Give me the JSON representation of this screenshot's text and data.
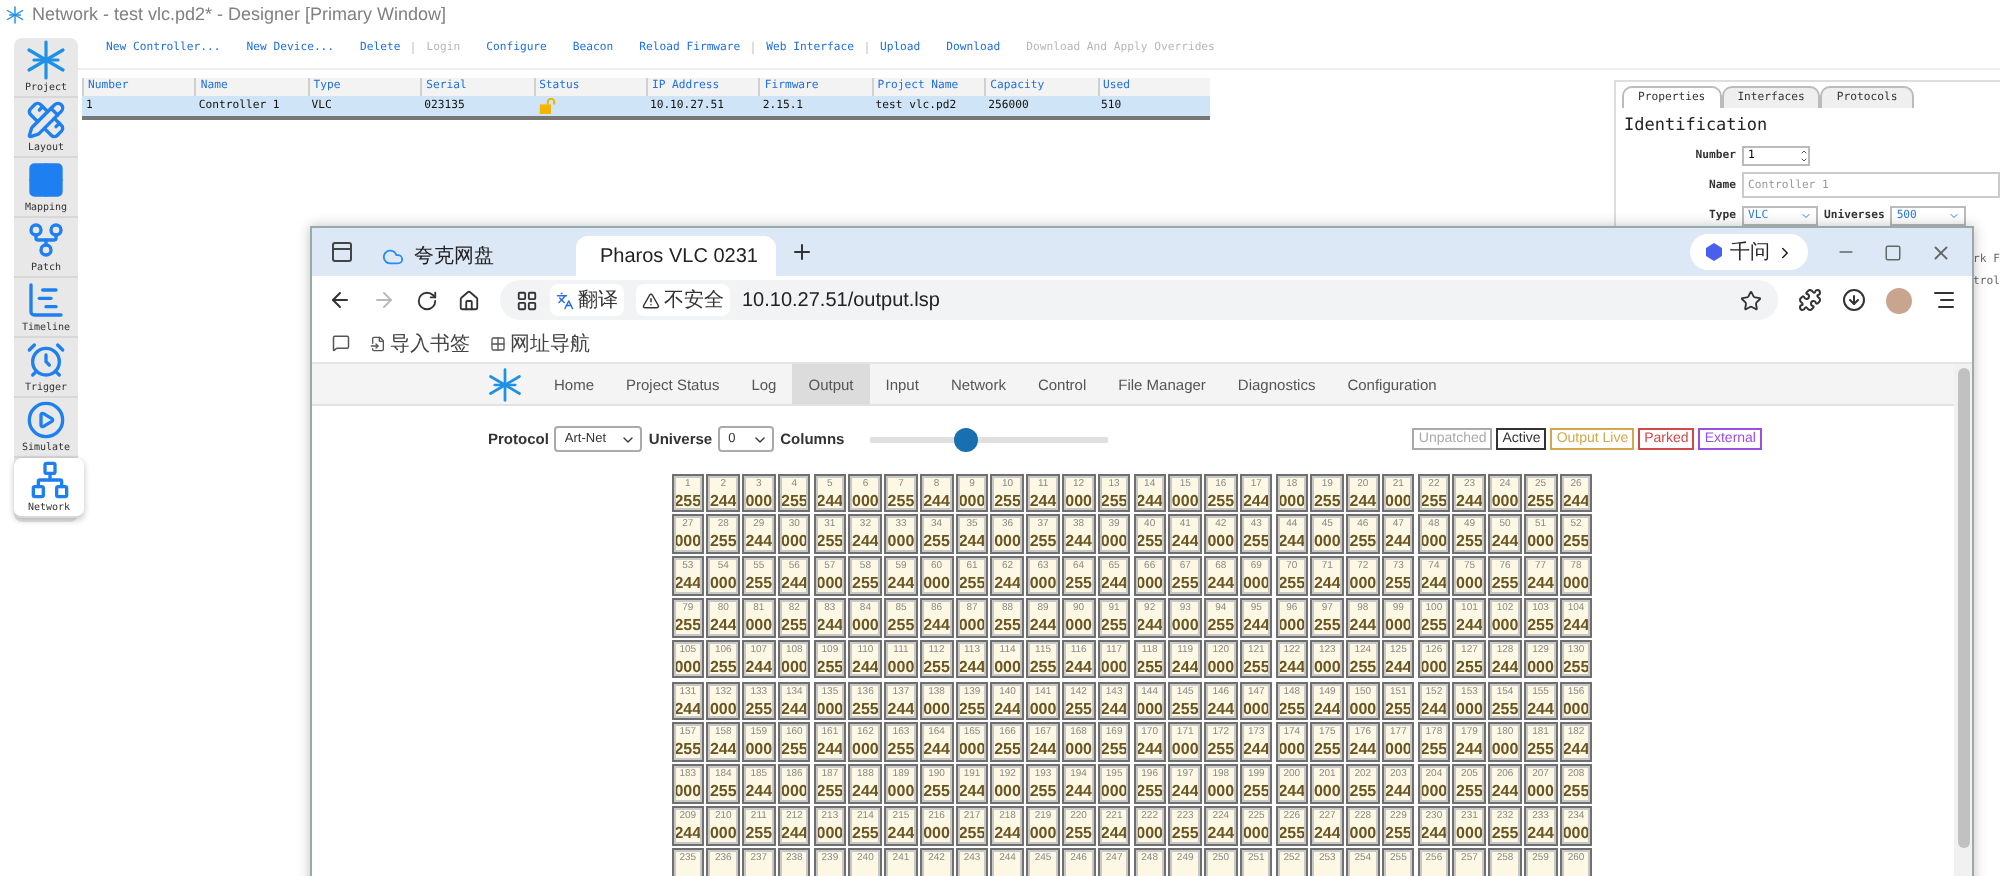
{
  "window": {
    "title": "Network - test vlc.pd2* - Designer [Primary Window]"
  },
  "sidebar": {
    "items": [
      {
        "label": "Project",
        "kind": "project",
        "selected": false
      },
      {
        "label": "Layout",
        "kind": "layout",
        "selected": false
      },
      {
        "label": "Mapping",
        "kind": "mapping",
        "selected": false
      },
      {
        "label": "Patch",
        "kind": "patch",
        "selected": false
      },
      {
        "label": "Timeline",
        "kind": "timeline",
        "selected": false
      },
      {
        "label": "Trigger",
        "kind": "trigger",
        "selected": false
      },
      {
        "label": "Simulate",
        "kind": "simulate",
        "selected": false
      },
      {
        "label": "Network",
        "kind": "network",
        "selected": true
      }
    ]
  },
  "toolbar": {
    "groups": [
      [
        {
          "label": "New Controller...",
          "disabled": false
        },
        {
          "label": "New Device...",
          "disabled": false
        },
        {
          "label": "Delete",
          "disabled": false
        }
      ],
      [
        {
          "label": "Login",
          "disabled": true
        },
        {
          "label": "Configure",
          "disabled": false
        },
        {
          "label": "Beacon",
          "disabled": false
        },
        {
          "label": "Reload Firmware",
          "disabled": false
        }
      ],
      [
        {
          "label": "Web Interface",
          "disabled": false
        }
      ],
      [
        {
          "label": "Upload",
          "disabled": false
        },
        {
          "label": "Download",
          "disabled": false
        },
        {
          "label": "Download And Apply Overrides",
          "disabled": true
        }
      ]
    ]
  },
  "table": {
    "columns": [
      "Number",
      "Name",
      "Type",
      "Serial",
      "Status",
      "IP Address",
      "Firmware",
      "Project Name",
      "Capacity",
      "Used"
    ],
    "rows": [
      {
        "selected": true,
        "locked": false,
        "cells": [
          "1",
          "Controller 1",
          "VLC",
          "023135",
          "",
          "10.10.27.51",
          "2.15.1",
          "test vlc.pd2",
          "256000",
          "510"
        ]
      }
    ]
  },
  "properties": {
    "tabs": [
      {
        "label": "Properties",
        "selected": true
      },
      {
        "label": "Interfaces",
        "selected": false
      },
      {
        "label": "Protocols",
        "selected": false
      }
    ],
    "heading": "Identification",
    "number": {
      "label": "Number",
      "value": "1"
    },
    "name": {
      "label": "Name",
      "placeholder": "Controller 1"
    },
    "type": {
      "label": "Type",
      "value": "VLC"
    },
    "universes": {
      "label": "Universes",
      "value": "500"
    },
    "hidden_texts": [
      "rk F",
      "trol"
    ]
  },
  "browser": {
    "tabs": [
      {
        "label": "夸克网盘",
        "selected": false
      },
      {
        "label": "Pharos VLC 0231",
        "selected": true
      }
    ],
    "assistant": "千问",
    "translate": "翻译",
    "security": "不安全",
    "url": "10.10.27.51/output.lsp",
    "bookmarks": [
      "导入书签",
      "网址导航"
    ],
    "page": {
      "nav": [
        {
          "label": "Home",
          "selected": false
        },
        {
          "label": "Project Status",
          "selected": false
        },
        {
          "label": "Log",
          "selected": false
        },
        {
          "label": "Output",
          "selected": true
        },
        {
          "label": "Input",
          "selected": false
        },
        {
          "label": "Network",
          "selected": false
        },
        {
          "label": "Control",
          "selected": false
        },
        {
          "label": "File Manager",
          "selected": false
        },
        {
          "label": "Diagnostics",
          "selected": false
        },
        {
          "label": "Configuration",
          "selected": false
        }
      ],
      "protocol": {
        "label": "Protocol",
        "value": "Art-Net"
      },
      "universe": {
        "label": "Universe",
        "value": "0"
      },
      "columns": {
        "label": "Columns",
        "level": 0.4
      },
      "legend": [
        {
          "label": "Unpatched",
          "color": "#aaaaaa"
        },
        {
          "label": "Active",
          "color": "#333333"
        },
        {
          "label": "Output Live",
          "color": "#d4a84a"
        },
        {
          "label": "Parked",
          "color": "#d04848"
        },
        {
          "label": "External",
          "color": "#9b4fe0"
        }
      ],
      "channels": [
        {
          "number": "1",
          "value": "255"
        },
        {
          "number": "2",
          "value": "244"
        },
        {
          "number": "3",
          "value": "000"
        },
        {
          "number": "4",
          "value": "255"
        },
        {
          "number": "5",
          "value": "244"
        },
        {
          "number": "6",
          "value": "000"
        },
        {
          "number": "7",
          "value": "255"
        },
        {
          "number": "8",
          "value": "244"
        },
        {
          "number": "9",
          "value": "000"
        },
        {
          "number": "10",
          "value": "255"
        },
        {
          "number": "11",
          "value": "244"
        },
        {
          "number": "12",
          "value": "000"
        },
        {
          "number": "13",
          "value": "255"
        },
        {
          "number": "14",
          "value": "244"
        },
        {
          "number": "15",
          "value": "000"
        },
        {
          "number": "16",
          "value": "255"
        },
        {
          "number": "17",
          "value": "244"
        },
        {
          "number": "18",
          "value": "000"
        },
        {
          "number": "19",
          "value": "255"
        },
        {
          "number": "20",
          "value": "244"
        },
        {
          "number": "21",
          "value": "000"
        },
        {
          "number": "22",
          "value": "255"
        },
        {
          "number": "23",
          "value": "244"
        },
        {
          "number": "24",
          "value": "000"
        },
        {
          "number": "25",
          "value": "255"
        },
        {
          "number": "26",
          "value": "244"
        },
        {
          "number": "27",
          "value": "000"
        },
        {
          "number": "28",
          "value": "255"
        },
        {
          "number": "29",
          "value": "244"
        },
        {
          "number": "30",
          "value": "000"
        },
        {
          "number": "31",
          "value": "255"
        },
        {
          "number": "32",
          "value": "244"
        },
        {
          "number": "33",
          "value": "000"
        },
        {
          "number": "34",
          "value": "255"
        },
        {
          "number": "35",
          "value": "244"
        },
        {
          "number": "36",
          "value": "000"
        },
        {
          "number": "37",
          "value": "255"
        },
        {
          "number": "38",
          "value": "244"
        },
        {
          "number": "39",
          "value": "000"
        },
        {
          "number": "40",
          "value": "255"
        },
        {
          "number": "41",
          "value": "244"
        },
        {
          "number": "42",
          "value": "000"
        },
        {
          "number": "43",
          "value": "255"
        },
        {
          "number": "44",
          "value": "244"
        },
        {
          "number": "45",
          "value": "000"
        },
        {
          "number": "46",
          "value": "255"
        },
        {
          "number": "47",
          "value": "244"
        },
        {
          "number": "48",
          "value": "000"
        },
        {
          "number": "49",
          "value": "255"
        },
        {
          "number": "50",
          "value": "244"
        },
        {
          "number": "51",
          "value": "000"
        },
        {
          "number": "52",
          "value": "255"
        },
        {
          "number": "53",
          "value": "244"
        },
        {
          "number": "54",
          "value": "000"
        },
        {
          "number": "55",
          "value": "255"
        },
        {
          "number": "56",
          "value": "244"
        },
        {
          "number": "57",
          "value": "000"
        },
        {
          "number": "58",
          "value": "255"
        },
        {
          "number": "59",
          "value": "244"
        },
        {
          "number": "60",
          "value": "000"
        },
        {
          "number": "61",
          "value": "255"
        },
        {
          "number": "62",
          "value": "244"
        },
        {
          "number": "63",
          "value": "000"
        },
        {
          "number": "64",
          "value": "255"
        },
        {
          "number": "65",
          "value": "244"
        },
        {
          "number": "66",
          "value": "000"
        },
        {
          "number": "67",
          "value": "255"
        },
        {
          "number": "68",
          "value": "244"
        },
        {
          "number": "69",
          "value": "000"
        },
        {
          "number": "70",
          "value": "255"
        },
        {
          "number": "71",
          "value": "244"
        },
        {
          "number": "72",
          "value": "000"
        },
        {
          "number": "73",
          "value": "255"
        },
        {
          "number": "74",
          "value": "244"
        },
        {
          "number": "75",
          "value": "000"
        },
        {
          "number": "76",
          "value": "255"
        },
        {
          "number": "77",
          "value": "244"
        },
        {
          "number": "78",
          "value": "000"
        },
        {
          "number": "79",
          "value": "255"
        },
        {
          "number": "80",
          "value": "244"
        },
        {
          "number": "81",
          "value": "000"
        },
        {
          "number": "82",
          "value": "255"
        },
        {
          "number": "83",
          "value": "244"
        },
        {
          "number": "84",
          "value": "000"
        },
        {
          "number": "85",
          "value": "255"
        },
        {
          "number": "86",
          "value": "244"
        },
        {
          "number": "87",
          "value": "000"
        },
        {
          "number": "88",
          "value": "255"
        },
        {
          "number": "89",
          "value": "244"
        },
        {
          "number": "90",
          "value": "000"
        },
        {
          "number": "91",
          "value": "255"
        },
        {
          "number": "92",
          "value": "244"
        },
        {
          "number": "93",
          "value": "000"
        },
        {
          "number": "94",
          "value": "255"
        },
        {
          "number": "95",
          "value": "244"
        },
        {
          "number": "96",
          "value": "000"
        },
        {
          "number": "97",
          "value": "255"
        },
        {
          "number": "98",
          "value": "244"
        },
        {
          "number": "99",
          "value": "000"
        },
        {
          "number": "100",
          "value": "255"
        },
        {
          "number": "101",
          "value": "244"
        },
        {
          "number": "102",
          "value": "000"
        },
        {
          "number": "103",
          "value": "255"
        },
        {
          "number": "104",
          "value": "244"
        },
        {
          "number": "105",
          "value": "000"
        },
        {
          "number": "106",
          "value": "255"
        },
        {
          "number": "107",
          "value": "244"
        },
        {
          "number": "108",
          "value": "000"
        },
        {
          "number": "109",
          "value": "255"
        },
        {
          "number": "110",
          "value": "244"
        },
        {
          "number": "111",
          "value": "000"
        },
        {
          "number": "112",
          "value": "255"
        },
        {
          "number": "113",
          "value": "244"
        },
        {
          "number": "114",
          "value": "000"
        },
        {
          "number": "115",
          "value": "255"
        },
        {
          "number": "116",
          "value": "244"
        },
        {
          "number": "117",
          "value": "000"
        },
        {
          "number": "118",
          "value": "255"
        },
        {
          "number": "119",
          "value": "244"
        },
        {
          "number": "120",
          "value": "000"
        },
        {
          "number": "121",
          "value": "255"
        },
        {
          "number": "122",
          "value": "244"
        },
        {
          "number": "123",
          "value": "000"
        },
        {
          "number": "124",
          "value": "255"
        },
        {
          "number": "125",
          "value": "244"
        },
        {
          "number": "126",
          "value": "000"
        },
        {
          "number": "127",
          "value": "255"
        },
        {
          "number": "128",
          "value": "244"
        },
        {
          "number": "129",
          "value": "000"
        },
        {
          "number": "130",
          "value": "255"
        },
        {
          "number": "131",
          "value": "244"
        },
        {
          "number": "132",
          "value": "000"
        },
        {
          "number": "133",
          "value": "255"
        },
        {
          "number": "134",
          "value": "244"
        },
        {
          "number": "135",
          "value": "000"
        },
        {
          "number": "136",
          "value": "255"
        },
        {
          "number": "137",
          "value": "244"
        },
        {
          "number": "138",
          "value": "000"
        },
        {
          "number": "139",
          "value": "255"
        },
        {
          "number": "140",
          "value": "244"
        },
        {
          "number": "141",
          "value": "000"
        },
        {
          "number": "142",
          "value": "255"
        },
        {
          "number": "143",
          "value": "244"
        },
        {
          "number": "144",
          "value": "000"
        },
        {
          "number": "145",
          "value": "255"
        },
        {
          "number": "146",
          "value": "244"
        },
        {
          "number": "147",
          "value": "000"
        },
        {
          "number": "148",
          "value": "255"
        },
        {
          "number": "149",
          "value": "244"
        },
        {
          "number": "150",
          "value": "000"
        },
        {
          "number": "151",
          "value": "255"
        },
        {
          "number": "152",
          "value": "244"
        },
        {
          "number": "153",
          "value": "000"
        },
        {
          "number": "154",
          "value": "255"
        },
        {
          "number": "155",
          "value": "244"
        },
        {
          "number": "156",
          "value": "000"
        },
        {
          "number": "157",
          "value": "255"
        },
        {
          "number": "158",
          "value": "244"
        },
        {
          "number": "159",
          "value": "000"
        },
        {
          "number": "160",
          "value": "255"
        },
        {
          "number": "161",
          "value": "244"
        },
        {
          "number": "162",
          "value": "000"
        },
        {
          "number": "163",
          "value": "255"
        },
        {
          "number": "164",
          "value": "244"
        },
        {
          "number": "165",
          "value": "000"
        },
        {
          "number": "166",
          "value": "255"
        },
        {
          "number": "167",
          "value": "244"
        },
        {
          "number": "168",
          "value": "000"
        },
        {
          "number": "169",
          "value": "255"
        },
        {
          "number": "170",
          "value": "244"
        },
        {
          "number": "171",
          "value": "000"
        },
        {
          "number": "172",
          "value": "255"
        },
        {
          "number": "173",
          "value": "244"
        },
        {
          "number": "174",
          "value": "000"
        },
        {
          "number": "175",
          "value": "255"
        },
        {
          "number": "176",
          "value": "244"
        },
        {
          "number": "177",
          "value": "000"
        },
        {
          "number": "178",
          "value": "255"
        },
        {
          "number": "179",
          "value": "244"
        },
        {
          "number": "180",
          "value": "000"
        },
        {
          "number": "181",
          "value": "255"
        },
        {
          "number": "182",
          "value": "244"
        },
        {
          "number": "183",
          "value": "000"
        },
        {
          "number": "184",
          "value": "255"
        },
        {
          "number": "185",
          "value": "244"
        },
        {
          "number": "186",
          "value": "000"
        },
        {
          "number": "187",
          "value": "255"
        },
        {
          "number": "188",
          "value": "244"
        },
        {
          "number": "189",
          "value": "000"
        },
        {
          "number": "190",
          "value": "255"
        },
        {
          "number": "191",
          "value": "244"
        },
        {
          "number": "192",
          "value": "000"
        },
        {
          "number": "193",
          "value": "255"
        },
        {
          "number": "194",
          "value": "244"
        },
        {
          "number": "195",
          "value": "000"
        },
        {
          "number": "196",
          "value": "255"
        },
        {
          "number": "197",
          "value": "244"
        },
        {
          "number": "198",
          "value": "000"
        },
        {
          "number": "199",
          "value": "255"
        },
        {
          "number": "200",
          "value": "244"
        },
        {
          "number": "201",
          "value": "000"
        },
        {
          "number": "202",
          "value": "255"
        },
        {
          "number": "203",
          "value": "244"
        },
        {
          "number": "204",
          "value": "000"
        },
        {
          "number": "205",
          "value": "255"
        },
        {
          "number": "206",
          "value": "244"
        },
        {
          "number": "207",
          "value": "000"
        },
        {
          "number": "208",
          "value": "255"
        },
        {
          "number": "209",
          "value": "244"
        },
        {
          "number": "210",
          "value": "000"
        },
        {
          "number": "211",
          "value": "255"
        },
        {
          "number": "212",
          "value": "244"
        },
        {
          "number": "213",
          "value": "000"
        },
        {
          "number": "214",
          "value": "255"
        },
        {
          "number": "215",
          "value": "244"
        },
        {
          "number": "216",
          "value": "000"
        },
        {
          "number": "217",
          "value": "255"
        },
        {
          "number": "218",
          "value": "244"
        },
        {
          "number": "219",
          "value": "000"
        },
        {
          "number": "220",
          "value": "255"
        },
        {
          "number": "221",
          "value": "244"
        },
        {
          "number": "222",
          "value": "000"
        },
        {
          "number": "223",
          "value": "255"
        },
        {
          "number": "224",
          "value": "244"
        },
        {
          "number": "225",
          "value": "000"
        },
        {
          "number": "226",
          "value": "255"
        },
        {
          "number": "227",
          "value": "244"
        },
        {
          "number": "228",
          "value": "000"
        },
        {
          "number": "229",
          "value": "255"
        },
        {
          "number": "230",
          "value": "244"
        },
        {
          "number": "231",
          "value": "000"
        },
        {
          "number": "232",
          "value": "255"
        },
        {
          "number": "233",
          "value": "244"
        },
        {
          "number": "234",
          "value": "000"
        },
        {
          "number": "235"
        },
        {
          "number": "236"
        },
        {
          "number": "237"
        },
        {
          "number": "238"
        },
        {
          "number": "239"
        },
        {
          "number": "240"
        },
        {
          "number": "241"
        },
        {
          "number": "242"
        },
        {
          "number": "243"
        },
        {
          "number": "244"
        },
        {
          "number": "245"
        },
        {
          "number": "246"
        },
        {
          "number": "247"
        },
        {
          "number": "248"
        },
        {
          "number": "249"
        },
        {
          "number": "250"
        },
        {
          "number": "251"
        },
        {
          "number": "252"
        },
        {
          "number": "253"
        },
        {
          "number": "254"
        },
        {
          "number": "255"
        },
        {
          "number": "256"
        },
        {
          "number": "257"
        },
        {
          "number": "258"
        },
        {
          "number": "259"
        },
        {
          "number": "260"
        }
      ]
    }
  }
}
